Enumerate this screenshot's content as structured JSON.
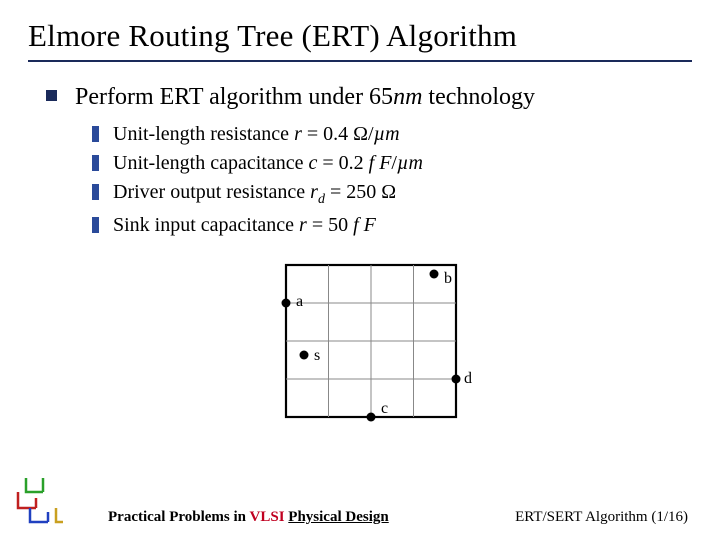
{
  "title": "Elmore Routing Tree (ERT) Algorithm",
  "heading_pre": "Perform ERT algorithm under 65",
  "heading_italic": "nm",
  "heading_post": " technology",
  "items": [
    {
      "pre": "Unit-length resistance ",
      "sym": "r",
      "expr": " = 0.4 Ω/",
      "unit": "µm"
    },
    {
      "pre": "Unit-length capacitance ",
      "sym": "c",
      "expr": " = 0.2 ",
      "mid_it": "f F",
      "post": "/",
      "unit": "µm"
    },
    {
      "pre": "Driver output resistance ",
      "sym": "r",
      "sub": "d",
      "expr": " = 250 Ω"
    },
    {
      "pre": "Sink input capacitance ",
      "sym": "r",
      "expr": " = 50 ",
      "mid_it": "f F"
    }
  ],
  "nodes": {
    "a": "a",
    "b": "b",
    "s": "s",
    "c": "c",
    "d": "d"
  },
  "footer": {
    "practical": "Practical Problems in ",
    "vlsi": "VLSI",
    "space": " ",
    "pd": "Physical Design",
    "right": "ERT/SERT Algorithm (1/16)"
  }
}
